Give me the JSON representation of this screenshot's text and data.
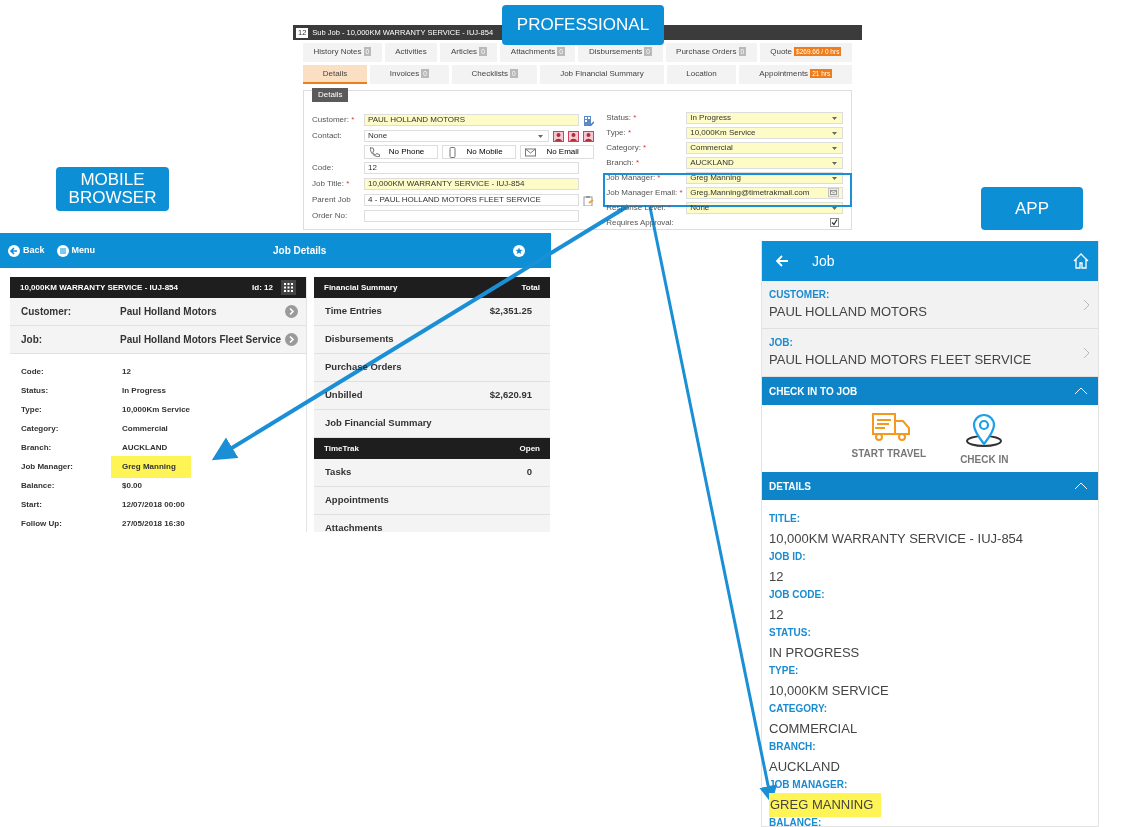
{
  "callouts": [
    {
      "text": "PROFESSIONAL"
    },
    {
      "text": "MOBILE BROWSER"
    },
    {
      "text": "APP"
    }
  ],
  "professional": {
    "window": {
      "badge": "12",
      "title": "Sub Job - 10,000KM WARRANTY SERVICE - IUJ-854"
    },
    "tabs_row_1": [
      {
        "label": "History Notes",
        "badge": {
          "kind": "count",
          "text": "0"
        },
        "selected": false
      },
      {
        "label": "Activities",
        "selected": false
      },
      {
        "label": "Articles",
        "badge": {
          "kind": "count",
          "text": "0"
        },
        "selected": false
      },
      {
        "label": "Attachments",
        "badge": {
          "kind": "count",
          "text": "0"
        },
        "selected": false
      },
      {
        "label": "Disbursements",
        "badge": {
          "kind": "count",
          "text": "0"
        },
        "selected": false
      },
      {
        "label": "Purchase Orders",
        "badge": {
          "kind": "count",
          "text": "0"
        },
        "selected": false
      },
      {
        "label": "Quote",
        "badge": {
          "kind": "alert",
          "text": "$269.66 / 0 hrs"
        },
        "selected": false
      }
    ],
    "tabs_row_2": [
      {
        "label": "Details",
        "selected": true
      },
      {
        "label": "Invoices",
        "badge": {
          "kind": "count",
          "text": "0"
        },
        "selected": false
      },
      {
        "label": "Checklists",
        "badge": {
          "kind": "count",
          "text": "0"
        },
        "selected": false
      },
      {
        "label": "Job Financial Summary",
        "selected": false
      },
      {
        "label": "Location",
        "selected": false
      },
      {
        "label": "Appointments",
        "badge": {
          "kind": "alert",
          "text": "21 hrs"
        },
        "selected": false
      }
    ],
    "details": {
      "legend": "Details",
      "left_fields": [
        {
          "kind": "lookup",
          "label": "Customer:",
          "marker": "*",
          "required": true,
          "value": "PAUL HOLLAND MOTORS"
        },
        {
          "kind": "contact",
          "label": "Contact:",
          "required": false,
          "value": "None",
          "buttons": [
            "No Phone",
            "No Mobile",
            "No Email"
          ]
        },
        {
          "kind": "text",
          "label": "Code:",
          "required": false,
          "value": "12"
        },
        {
          "kind": "text",
          "label": "Job Title:",
          "marker": "*",
          "required": true,
          "value": "10,000KM WARRANTY SERVICE - IUJ-854"
        },
        {
          "kind": "attach",
          "label": "Parent Job",
          "required": false,
          "value": "4 - PAUL HOLLAND MOTORS FLEET SERVICE"
        },
        {
          "kind": "text",
          "label": "Order No:",
          "required": false
        }
      ],
      "right_fields": [
        {
          "kind": "select",
          "label": "Status:",
          "marker": "*",
          "required": true,
          "value": "In Progress"
        },
        {
          "kind": "select",
          "label": "Type:",
          "marker": "*",
          "required": true,
          "value": "10,000Km Service"
        },
        {
          "kind": "select",
          "label": "Category:",
          "marker": "*",
          "required": true,
          "value": "Commercial"
        },
        {
          "kind": "select",
          "label": "Branch:",
          "marker": "*",
          "required": true,
          "value": "AUCKLAND"
        },
        {
          "kind": "select",
          "label": "Job Manager:",
          "marker": "*",
          "required": true,
          "value": "Greg Manning"
        },
        {
          "kind": "email",
          "label": "Job Manager Email:",
          "marker": "*",
          "required": true,
          "value": "Greg.Manning@timetrakmail.com"
        },
        {
          "kind": "select",
          "label": "Response Level:",
          "marker": "*",
          "required": true,
          "value": "None"
        },
        {
          "kind": "checkbox",
          "label": "Requires Approval:",
          "checked": true
        }
      ]
    }
  },
  "mobile": {
    "header": {
      "back": "Back",
      "menu": "Menu",
      "title": "Job Details"
    },
    "job_card": {
      "title": "10,000KM WARRANTY SERVICE - IUJ-854",
      "id": "Id: 12",
      "links": [
        {
          "label": "Customer:",
          "value": "Paul Holland Motors"
        },
        {
          "label": "Job:",
          "value": "Paul Holland Motors Fleet Service"
        }
      ],
      "fields": [
        {
          "label": "Code:",
          "value": "12",
          "highlighted": false
        },
        {
          "label": "Status:",
          "value": "In Progress",
          "highlighted": false
        },
        {
          "label": "Type:",
          "value": "10,000Km Service",
          "highlighted": false
        },
        {
          "label": "Category:",
          "value": "Commercial",
          "highlighted": false
        },
        {
          "label": "Branch:",
          "value": "AUCKLAND",
          "highlighted": false
        },
        {
          "label": "Job Manager:",
          "value": "Greg Manning",
          "highlighted": true
        },
        {
          "label": "Balance:",
          "value": "$0.00",
          "highlighted": false
        },
        {
          "label": "Start:",
          "value": "12/07/2018 00:00",
          "highlighted": false
        },
        {
          "label": "Follow Up:",
          "value": "27/05/2018 16:30",
          "highlighted": false
        }
      ]
    },
    "panels": [
      {
        "header": "Financial Summary",
        "header_right": "Total",
        "rows": [
          {
            "label": "Time Entries",
            "value": "$2,351.25"
          },
          {
            "label": "Disbursements"
          },
          {
            "label": "Purchase Orders"
          },
          {
            "label": "Unbilled",
            "value": "$2,620.91"
          },
          {
            "label": "Job Financial Summary"
          }
        ]
      },
      {
        "header": "TimeTrak",
        "header_right": "Open",
        "rows": [
          {
            "label": "Tasks",
            "value": "0"
          },
          {
            "label": "Appointments"
          },
          {
            "label": "Attachments"
          }
        ]
      }
    ]
  },
  "app": {
    "header": {
      "title": "Job"
    },
    "links": [
      {
        "label": "CUSTOMER:",
        "value": "PAUL HOLLAND MOTORS"
      },
      {
        "label": "JOB:",
        "value": "PAUL HOLLAND MOTORS FLEET SERVICE"
      }
    ],
    "check_in": {
      "title": "CHECK IN TO JOB",
      "expanded": true,
      "actions": [
        {
          "kind": "travel",
          "label": "START TRAVEL"
        },
        {
          "kind": "checkin",
          "label": "CHECK IN"
        }
      ]
    },
    "details": {
      "title": "DETAILS",
      "expanded": true,
      "fields": [
        {
          "label": "TITLE:",
          "value": "10,000KM WARRANTY SERVICE - IUJ-854",
          "highlighted": false
        },
        {
          "label": "JOB ID:",
          "value": "12",
          "highlighted": false
        },
        {
          "label": "JOB CODE:",
          "value": "12",
          "highlighted": false
        },
        {
          "label": "STATUS:",
          "value": "IN PROGRESS",
          "highlighted": false
        },
        {
          "label": "TYPE:",
          "value": "10,000KM SERVICE",
          "highlighted": false
        },
        {
          "label": "CATEGORY:",
          "value": "COMMERCIAL",
          "highlighted": false
        },
        {
          "label": "BRANCH:",
          "value": "AUCKLAND",
          "highlighted": false
        },
        {
          "label": "JOB MANAGER:",
          "value": "GREG MANNING",
          "highlighted": true
        },
        {
          "label": "BALANCE:"
        }
      ]
    }
  }
}
